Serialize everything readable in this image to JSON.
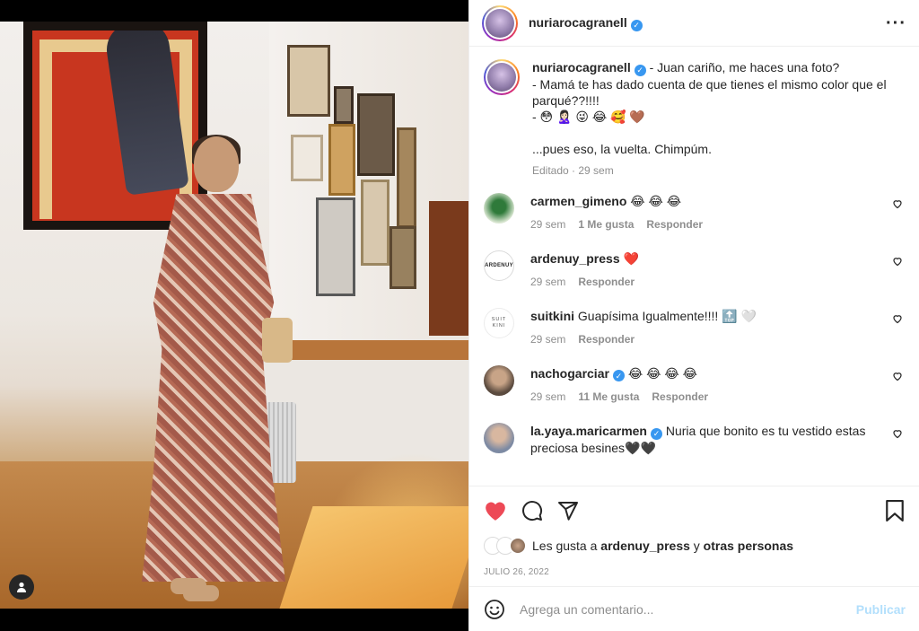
{
  "post": {
    "author": "nuriarocagranell",
    "caption_lines": [
      "- Juan cariño, me haces una foto?",
      "- Mamá te has dado cuenta de que tienes el mismo color que el parqué??!!!!",
      "- 😳 🙎🏻‍♀️ 😜 😂 🥰 🤎",
      "...pues eso, la vuelta. Chimpúm."
    ],
    "edited": "Editado · 29 sem"
  },
  "comments": [
    {
      "user": "carmen_gimeno",
      "text": "😂 😂 😂",
      "time": "29 sem",
      "likes": "1 Me gusta",
      "reply": "Responder",
      "verified": false
    },
    {
      "user": "ardenuy_press",
      "text": "❤️",
      "time": "29 sem",
      "likes": "",
      "reply": "Responder",
      "verified": false,
      "avatar_text": "ARDENUY"
    },
    {
      "user": "suitkini",
      "text": "Guapísima Igualmente!!!! 🔝 🤍",
      "time": "29 sem",
      "likes": "",
      "reply": "Responder",
      "verified": false,
      "avatar_text": "SUIT KINI"
    },
    {
      "user": "nachogarciar",
      "text": "😂 😂 😂 😂",
      "time": "29 sem",
      "likes": "11 Me gusta",
      "reply": "Responder",
      "verified": true
    },
    {
      "user": "la.yaya.maricarmen",
      "text": "Nuria que bonito es tu vestido estas preciosa besines🖤🖤",
      "time": "",
      "likes": "",
      "reply": "",
      "verified": true
    }
  ],
  "likes": {
    "prefix": "Les gusta a",
    "user": "ardenuy_press",
    "joiner": "y",
    "others": "otras personas"
  },
  "date": "JULIO 26, 2022",
  "add_comment": {
    "placeholder": "Agrega un comentario...",
    "publish": "Publicar"
  },
  "icons": {
    "like": "heart-filled-icon",
    "comment": "comment-bubble-icon",
    "share": "paper-plane-icon",
    "save": "bookmark-icon",
    "emoji": "smiley-icon",
    "more": "more-options-icon",
    "tag": "user-tag-icon",
    "verified": "verified-badge-icon"
  },
  "colors": {
    "like_red": "#ed4956",
    "verified_blue": "#3897f0",
    "publish_disabled": "#b2dffc",
    "muted": "#8e8e8e"
  }
}
